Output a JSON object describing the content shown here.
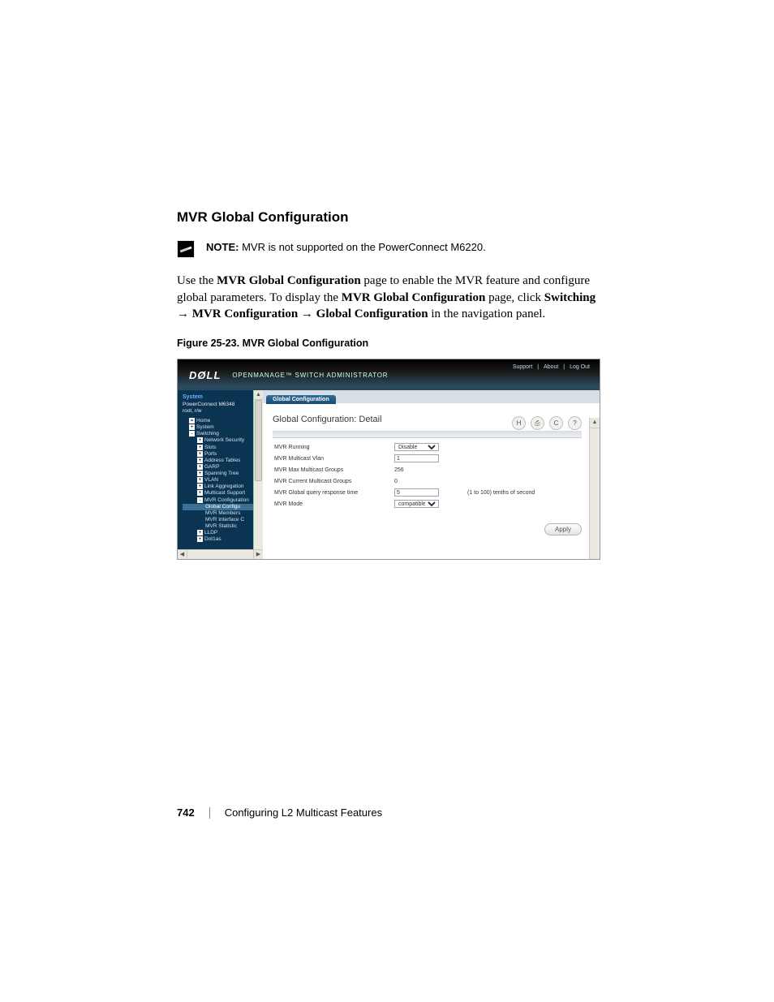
{
  "doc": {
    "section_title": "MVR Global Configuration",
    "note_label": "NOTE:",
    "note_text": " MVR is not supported on the PowerConnect M6220.",
    "para_pre": "Use the ",
    "para_b1": "MVR Global Configuration",
    "para_mid1": " page to enable the MVR feature and configure global parameters. To display the ",
    "para_b2": "MVR Global Configuration",
    "para_mid2": " page, click ",
    "nav1": "Switching",
    "arrow": " → ",
    "nav2": "MVR Configuration",
    "nav3": "Global Configuration",
    "para_end": " in the navigation panel.",
    "figure_caption_num": "Figure 25-23.",
    "figure_caption_spacer": "    ",
    "figure_caption_title": "MVR Global Configuration"
  },
  "ss": {
    "logo": "DØLL",
    "suite": "OPENMANAGE™ SWITCH ADMINISTRATOR",
    "toplinks": {
      "support": "Support",
      "about": "About",
      "logout": "Log Out",
      "sep": " | "
    },
    "sidebar": {
      "system": "System",
      "model": "PowerConnect M6348",
      "user": "root, r/w",
      "tree": [
        {
          "lvl": 0,
          "toggler": "=",
          "label": "Home"
        },
        {
          "lvl": 0,
          "toggler": "+",
          "label": "System"
        },
        {
          "lvl": 0,
          "toggler": "-",
          "label": "Switching"
        },
        {
          "lvl": 1,
          "toggler": "+",
          "label": "Network Security"
        },
        {
          "lvl": 1,
          "toggler": "+",
          "label": "Slots"
        },
        {
          "lvl": 1,
          "toggler": "+",
          "label": "Ports"
        },
        {
          "lvl": 1,
          "toggler": "+",
          "label": "Address Tables"
        },
        {
          "lvl": 1,
          "toggler": "+",
          "label": "GARP"
        },
        {
          "lvl": 1,
          "toggler": "+",
          "label": "Spanning Tree"
        },
        {
          "lvl": 1,
          "toggler": "+",
          "label": "VLAN"
        },
        {
          "lvl": 1,
          "toggler": "+",
          "label": "Link Aggregation"
        },
        {
          "lvl": 1,
          "toggler": "+",
          "label": "Multicast Support"
        },
        {
          "lvl": 1,
          "toggler": "-",
          "label": "MVR Configuration"
        },
        {
          "lvl": 2,
          "toggler": "",
          "label": "Global Configu",
          "selected": true
        },
        {
          "lvl": 2,
          "toggler": "",
          "label": "MVR Members"
        },
        {
          "lvl": 2,
          "toggler": "",
          "label": "MVR Interface C"
        },
        {
          "lvl": 2,
          "toggler": "",
          "label": "MVR Statistic"
        },
        {
          "lvl": 1,
          "toggler": "+",
          "label": "LLDP"
        },
        {
          "lvl": 1,
          "toggler": "+",
          "label": "Dot1as"
        }
      ]
    },
    "tab": "Global Configuration",
    "panel_title": "Global Configuration: Detail",
    "icons": {
      "save": "H",
      "print": "⎙",
      "refresh": "C",
      "help": "?"
    },
    "form": {
      "rows": [
        {
          "label": "MVR Running",
          "type": "select",
          "value": "Disable"
        },
        {
          "label": "MVR Multicast Vlan",
          "type": "input",
          "value": "1"
        },
        {
          "label": "MVR Max Multicast Groups",
          "type": "static",
          "value": "256"
        },
        {
          "label": "MVR Current Multicast Groups",
          "type": "static",
          "value": "0"
        },
        {
          "label": "MVR Global query response time",
          "type": "input",
          "value": "5",
          "hint": "(1 to 100) tenths of second"
        },
        {
          "label": "MVR Mode",
          "type": "select",
          "value": "compatible"
        }
      ],
      "apply": "Apply"
    }
  },
  "footer": {
    "page_num": "742",
    "chapter": "Configuring L2 Multicast Features"
  }
}
